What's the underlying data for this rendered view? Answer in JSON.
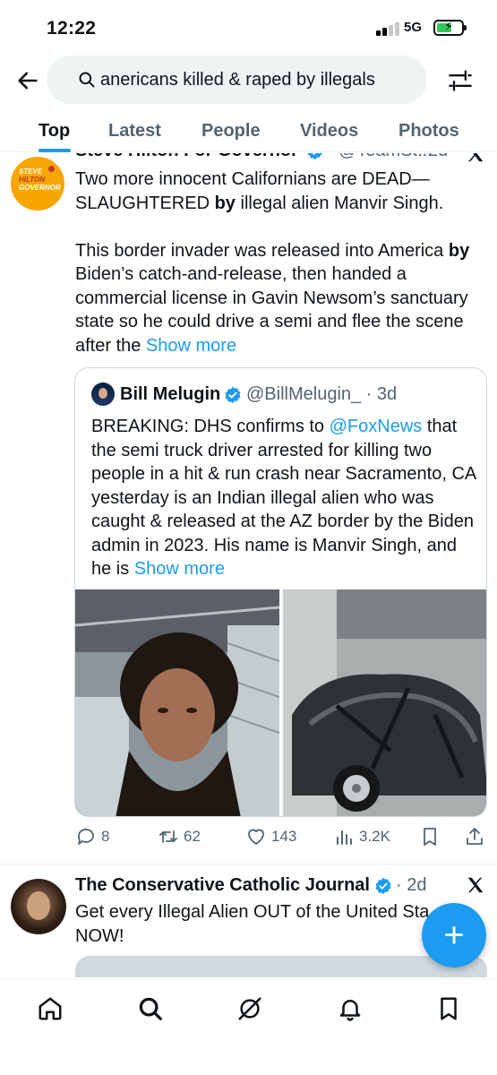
{
  "status_bar": {
    "time": "12:22",
    "network": "5G",
    "battery_level": 0.62
  },
  "search": {
    "query": "anericans killed & raped by illegals",
    "back_icon": "arrow-left-icon",
    "filter_icon": "sliders-icon"
  },
  "tabs": [
    {
      "label": "Top",
      "active": true
    },
    {
      "label": "Latest",
      "active": false
    },
    {
      "label": "People",
      "active": false
    },
    {
      "label": "Videos",
      "active": false
    },
    {
      "label": "Photos",
      "active": false
    }
  ],
  "tweet1": {
    "author": "Steve Hilton For Governor",
    "handle": "@TeamSt...",
    "time": "2d",
    "avatar_text": [
      "STEVE",
      "HILTON",
      "GOVERNOR"
    ],
    "body_line1_a": "Two more innocent Californians are DEAD—",
    "body_line2_a": "SLAUGHTERED ",
    "body_line2_b": "by",
    "body_line2_c": " illegal alien Manvir Singh.",
    "body_p2_a": "This border invader was released into America ",
    "body_p2_b": "by",
    "body_p2_c": "Biden’s catch-and-release, then handed a commercial license in Gavin Newsom’s sanctuary state so he could drive a semi and flee the scene after the ",
    "show_more": "Show more",
    "quote": {
      "author": "Bill Melugin",
      "handle": "@BillMelugin_ · 3d",
      "body_a": "BREAKING: DHS confirms to ",
      "mention": "@FoxNews",
      "body_b": " that the semi truck driver arrested for killing two people in a hit & run crash near Sacramento, CA yesterday is an Indian illegal alien who was caught & released at the AZ border by the Biden admin in 2023. His name is Manvir Singh, and he is ",
      "show_more": "Show more"
    },
    "actions": {
      "replies": "8",
      "reposts": "62",
      "likes": "143",
      "views": "3.2K"
    }
  },
  "tweet2": {
    "author": "The Conservative Catholic Journal",
    "time": "· 2d",
    "line1": "Get every Illegal Alien OUT of the United Sta",
    "line2": "NOW!"
  },
  "fab_label": "+",
  "colors": {
    "accent": "#1d9bf0",
    "text": "#0f1419",
    "muted": "#536471",
    "border": "#cfd9de"
  }
}
